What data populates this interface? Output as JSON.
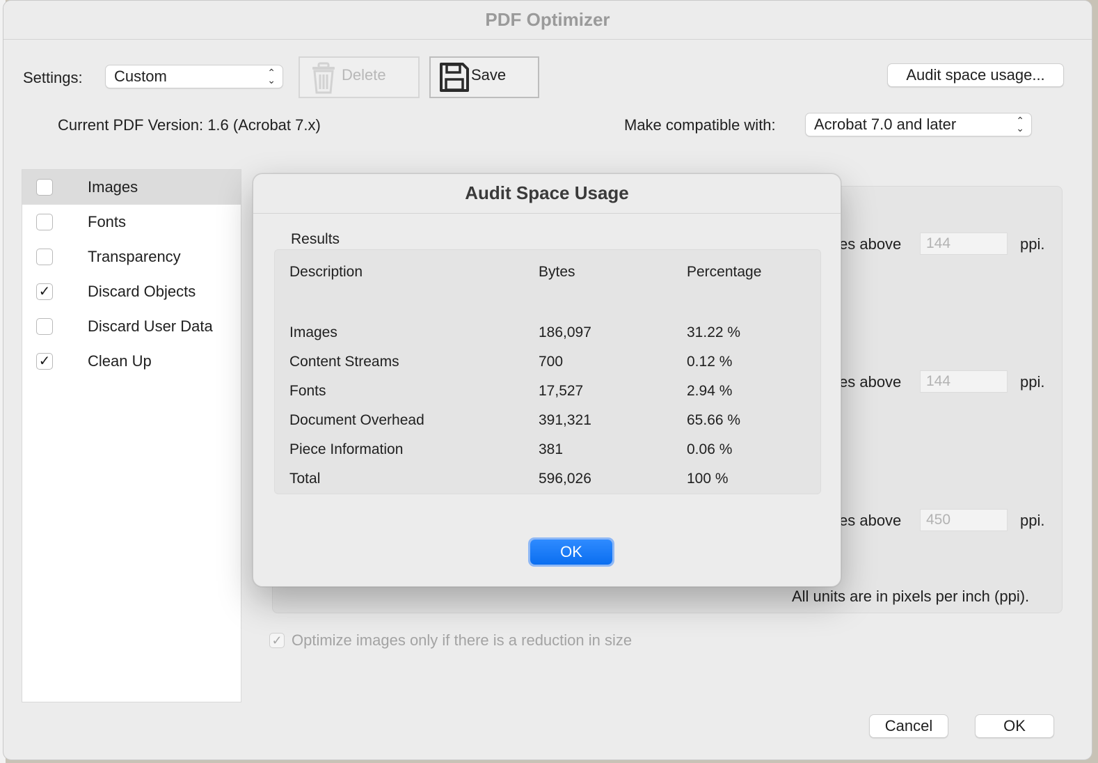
{
  "window": {
    "title": "PDF Optimizer"
  },
  "toolbar": {
    "settings_label": "Settings:",
    "settings_value": "Custom",
    "delete_label": "Delete",
    "save_label": "Save",
    "audit_button": "Audit space usage..."
  },
  "version": {
    "current": "Current PDF Version: 1.6 (Acrobat 7.x)",
    "compatible_label": "Make compatible with:",
    "compatible_value": "Acrobat 7.0 and later"
  },
  "sidebar": {
    "items": [
      {
        "label": "Images",
        "checked": false,
        "selected": true
      },
      {
        "label": "Fonts",
        "checked": false,
        "selected": false
      },
      {
        "label": "Transparency",
        "checked": false,
        "selected": false
      },
      {
        "label": "Discard Objects",
        "checked": true,
        "selected": false
      },
      {
        "label": "Discard User Data",
        "checked": false,
        "selected": false
      },
      {
        "label": "Clean Up",
        "checked": true,
        "selected": false
      }
    ]
  },
  "image_settings": {
    "partial_text": "es above",
    "ppi_values": [
      "144",
      "144",
      "450"
    ],
    "unit": "ppi.",
    "units_note": "All units are in pixels per inch (ppi).",
    "optimize_only_label": "Optimize images only if there is a reduction in size",
    "optimize_only_checked": true
  },
  "footer": {
    "cancel_label": "Cancel",
    "ok_label": "OK"
  },
  "audit_dialog": {
    "title": "Audit Space Usage",
    "results_label": "Results",
    "columns": [
      "Description",
      "Bytes",
      "Percentage"
    ],
    "rows": [
      [
        "Images",
        "186,097",
        "31.22 %"
      ],
      [
        "Content Streams",
        "700",
        "0.12 %"
      ],
      [
        "Fonts",
        "17,527",
        "2.94 %"
      ],
      [
        "Document Overhead",
        "391,321",
        "65.66 %"
      ],
      [
        "Piece Information",
        "381",
        "0.06 %"
      ],
      [
        "Total",
        "596,026",
        "100 %"
      ]
    ],
    "ok_label": "OK"
  },
  "colors": {
    "accent": "#0a6ef0",
    "window_bg": "#ececec"
  },
  "icons": {
    "delete": "trash-icon",
    "save": "floppy-disk-icon"
  }
}
